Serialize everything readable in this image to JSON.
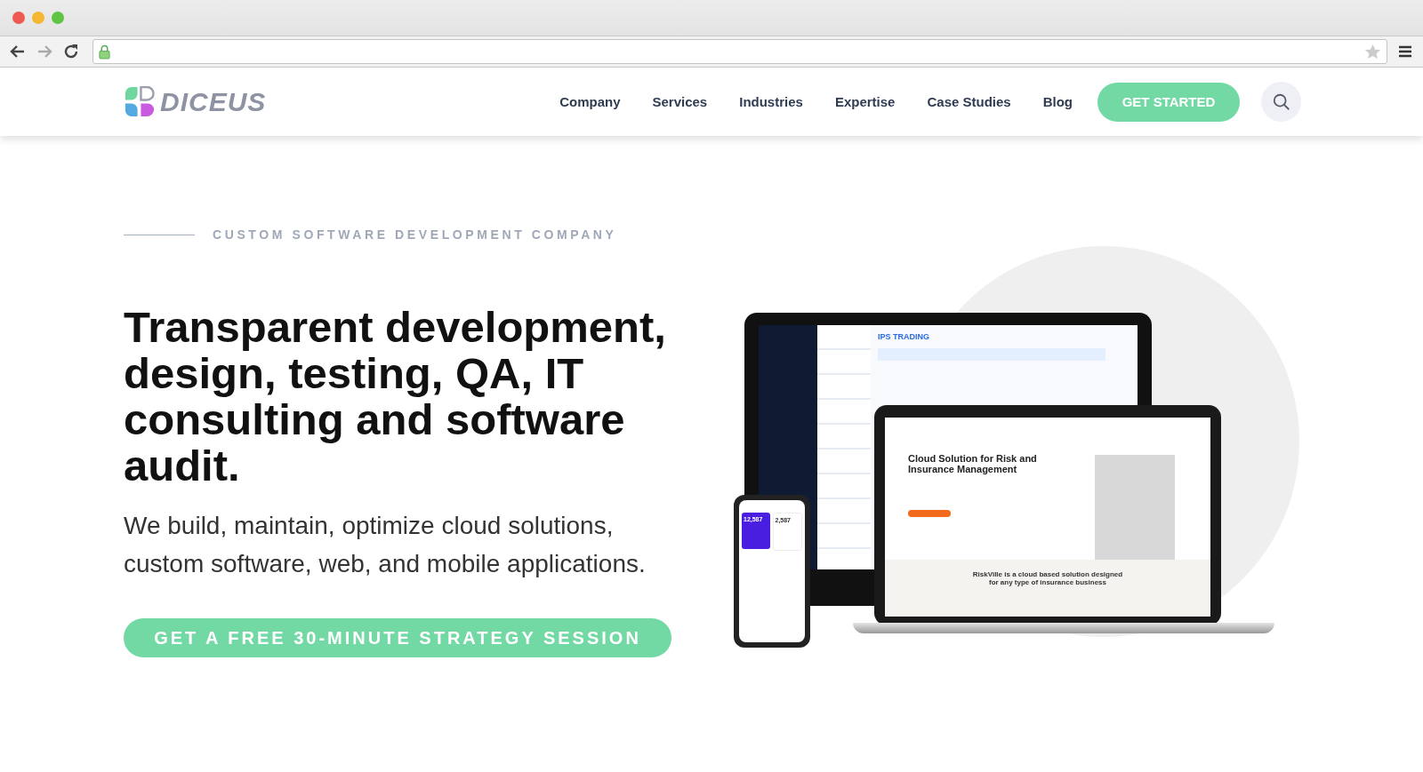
{
  "logo": {
    "text": "DICEUS"
  },
  "nav": [
    {
      "label": "Company"
    },
    {
      "label": "Services"
    },
    {
      "label": "Industries"
    },
    {
      "label": "Expertise"
    },
    {
      "label": "Case Studies"
    },
    {
      "label": "Blog"
    }
  ],
  "header_button": "GET STARTED",
  "hero": {
    "eyebrow": "CUSTOM SOFTWARE DEVELOPMENT COMPANY",
    "title": "Transparent development, design, testing, QA, IT consulting and software audit.",
    "subtitle": "We build, maintain, optimize cloud solutions, custom software, web, and mobile applications.",
    "cta": "GET A FREE 30-MINUTE STRATEGY SESSION"
  },
  "mockup": {
    "monitor_title": "IPS TRADING",
    "laptop_heading": "Cloud Solution for Risk and Insurance Management",
    "laptop_tagline": "RiskVille is a cloud based solution designed for any type of insurance business",
    "phone_values": [
      "12,587",
      "2,587"
    ]
  }
}
